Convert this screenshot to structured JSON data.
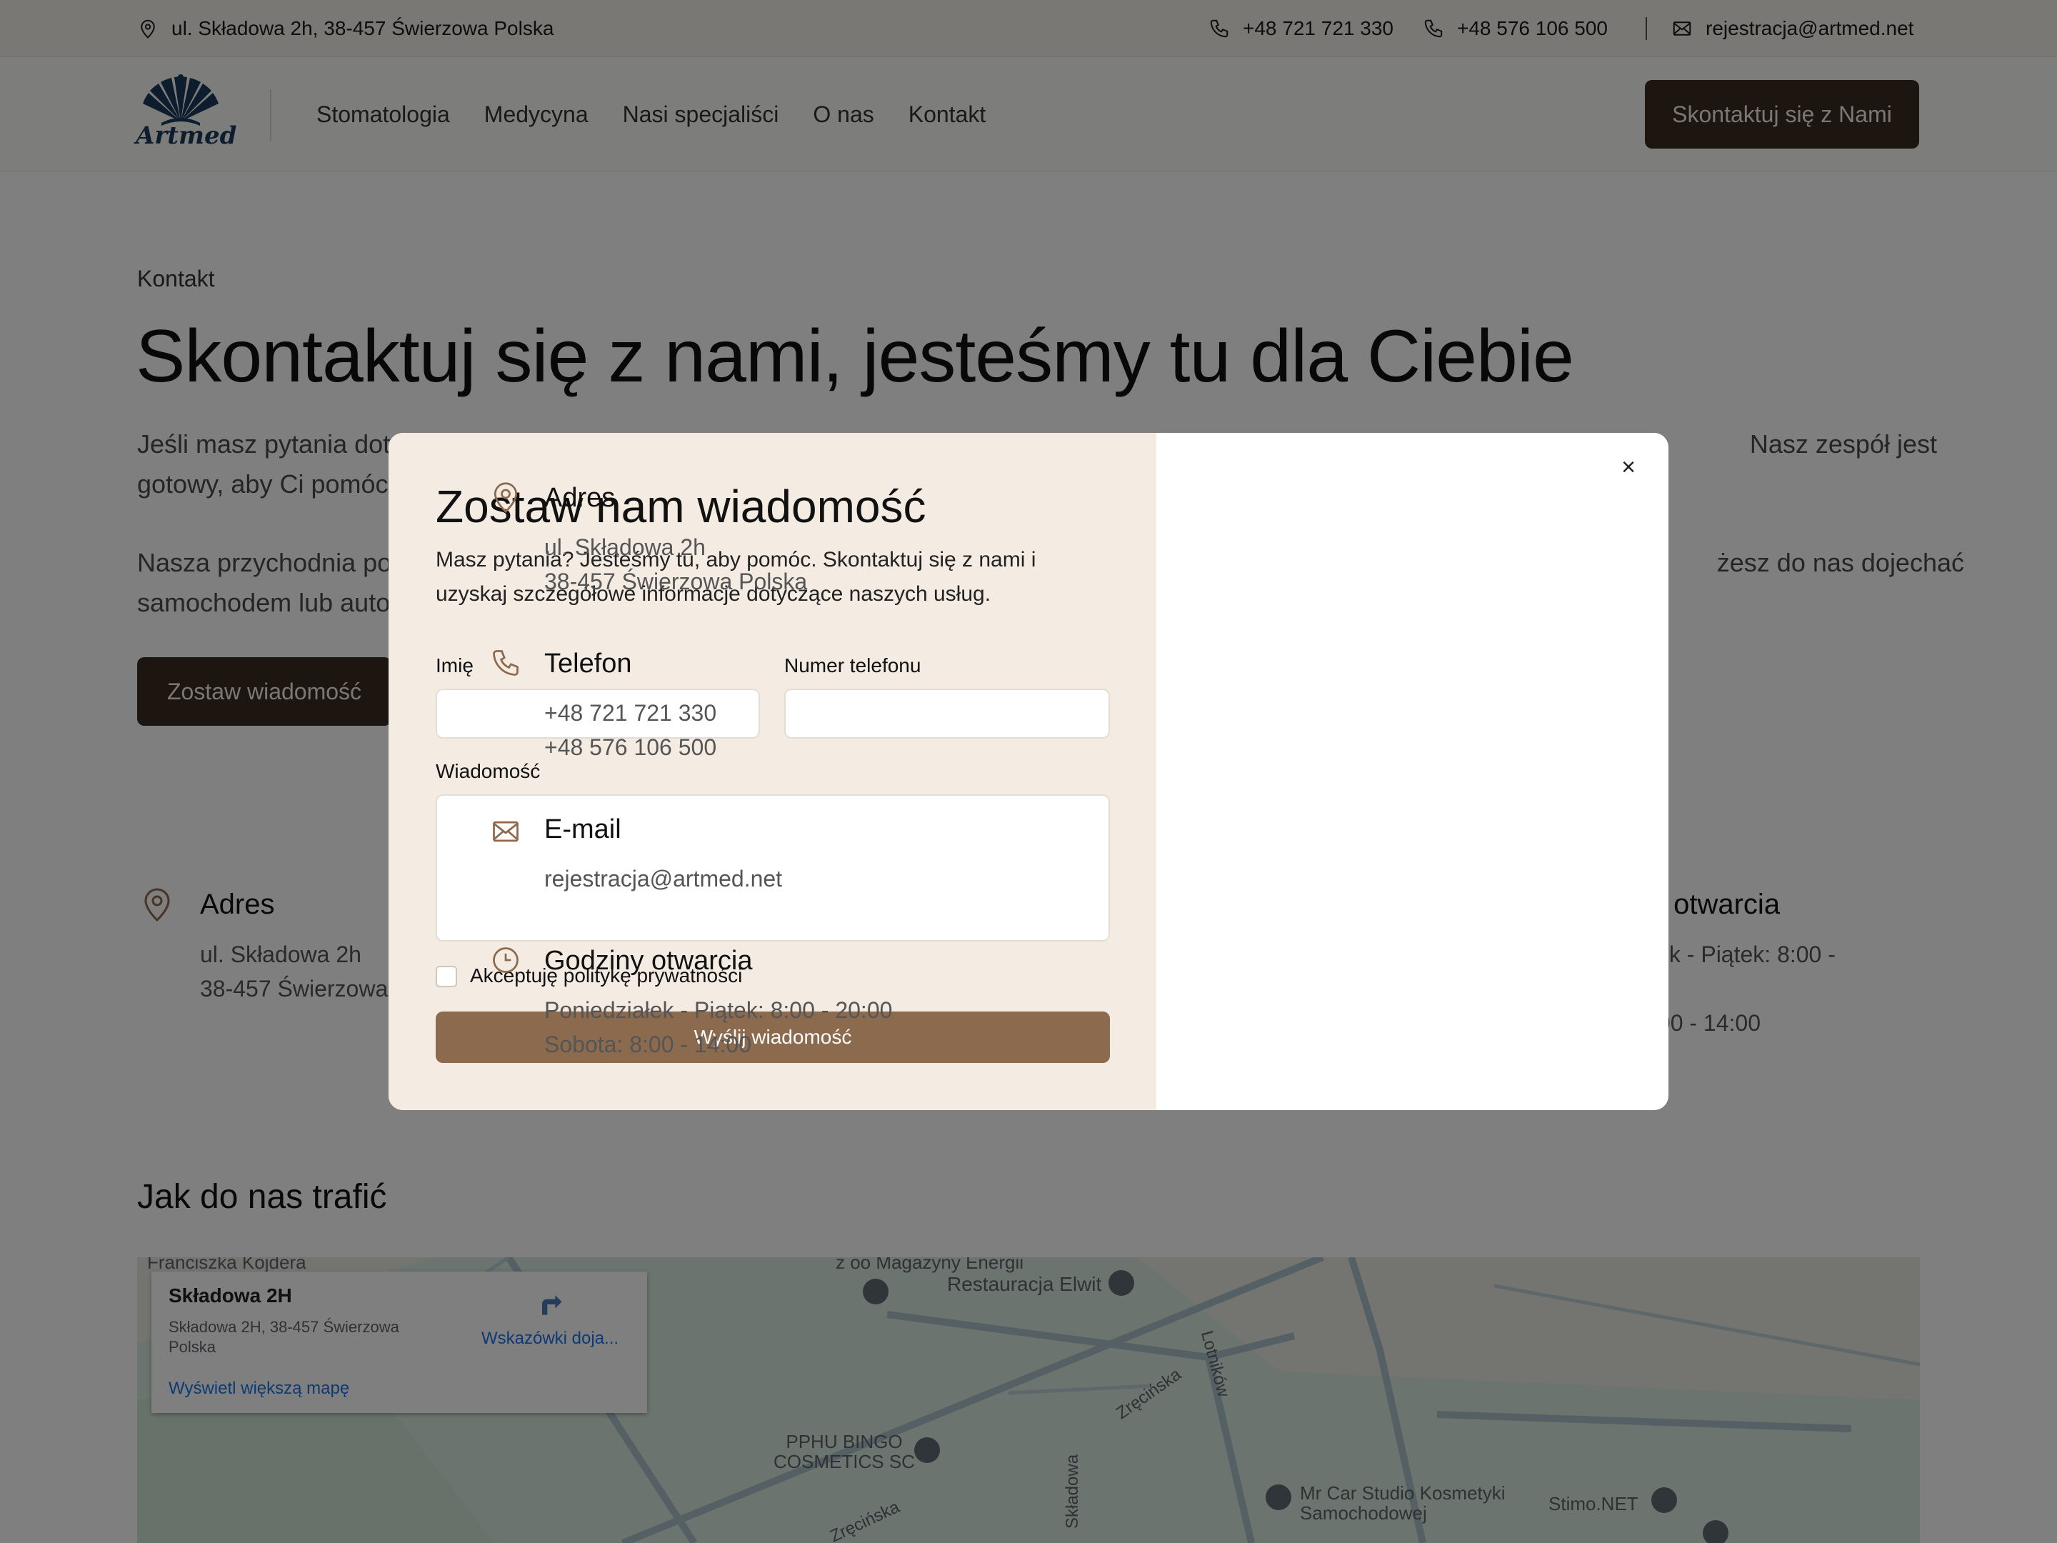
{
  "topbar": {
    "address": "ul. Składowa 2h, 38-457 Świerzowa Polska",
    "phone1": "+48 721 721 330",
    "phone2": "+48 576 106 500",
    "email": "rejestracja@artmed.net"
  },
  "header": {
    "logo_text": "Artmed",
    "nav": [
      "Stomatologia",
      "Medycyna",
      "Nasi specjaliści",
      "O nas",
      "Kontakt"
    ],
    "cta_label": "Skontaktuj się z Nami"
  },
  "main": {
    "breadcrumb": "Kontakt",
    "title": "Skontaktuj się z nami, jesteśmy tu dla Ciebie",
    "para1_line1_start": "Jeśli masz pytania doty",
    "para1_line1_end": "Nasz zespół jest",
    "para1_line2_start": "gotowy, aby Ci pomóc",
    "para2_line1_start": "Nasza przychodnia po",
    "para2_line1_end": "żesz do nas dojechać",
    "para2_line2_start": "samochodem lub auto",
    "button_label": "Zostaw wiadomość",
    "address_title": "Adres",
    "address_line1": "ul. Składowa 2h",
    "address_line2": "38-457 Świerzowa",
    "hours_title_partial": "y otwarcia",
    "hours_line1_partial": "łek - Piątek: 8:00 -",
    "hours_line2_partial": ":00 - 14:00",
    "directions_title": "Jak do nas trafić"
  },
  "map": {
    "card_title": "Składowa 2H",
    "card_address": "Składowa 2H, 38-457 Świerzowa Polska",
    "directions_label": "Wskazówki doja...",
    "larger_map_link": "Wyświetl większą mapę",
    "labels": [
      "Franciszka Kojdera",
      "z oo Magazyny Energii",
      "Restauracja Elwit",
      "Lotników",
      "Zręcińska",
      "PPHU BINGO COSMETICS SC",
      "Składowa",
      "Mr Car Studio Kosmetyki Samochodowej",
      "Stimo.NET",
      "Zręcińska"
    ]
  },
  "modal": {
    "title": "Zostaw nam wiadomość",
    "subtitle": "Masz pytania? Jesteśmy tu, aby pomóc. Skontaktuj się z nami i uzyskaj szczegółowe informacje dotyczące naszych usług.",
    "name_label": "Imię",
    "phone_label": "Numer telefonu",
    "message_label": "Wiadomość",
    "name_value": "",
    "phone_value": "",
    "message_value": "",
    "privacy_label": "Akceptuję politykę prywatności",
    "privacy_checked": false,
    "submit_label": "Wyślij wiadomość",
    "close_symbol": "×",
    "address_title": "Adres",
    "address_line1": "ul. Składowa 2h",
    "address_line2": "38-457 Świerzowa Polska",
    "phone_title": "Telefon",
    "phone1": "+48 721 721 330",
    "phone2": "+48 576 106 500",
    "email_title": "E-mail",
    "email": "rejestracja@artmed.net",
    "hours_title": "Godziny otwarcia",
    "hours_line1": "Poniedziałek - Piątek: 8:00 - 20:00",
    "hours_line2": "Sobota: 8:00 - 14:00"
  },
  "colors": {
    "dark_brown": "#3b2a1e",
    "submit_brown": "#8b6a4e",
    "modal_left_bg": "#f4ebe2",
    "icon_brown": "#8b6a4e",
    "logo_blue": "#1b3a5c"
  },
  "icons": [
    "map-pin-icon",
    "phone-icon",
    "mail-icon",
    "clock-icon",
    "close-icon",
    "directions-icon"
  ]
}
